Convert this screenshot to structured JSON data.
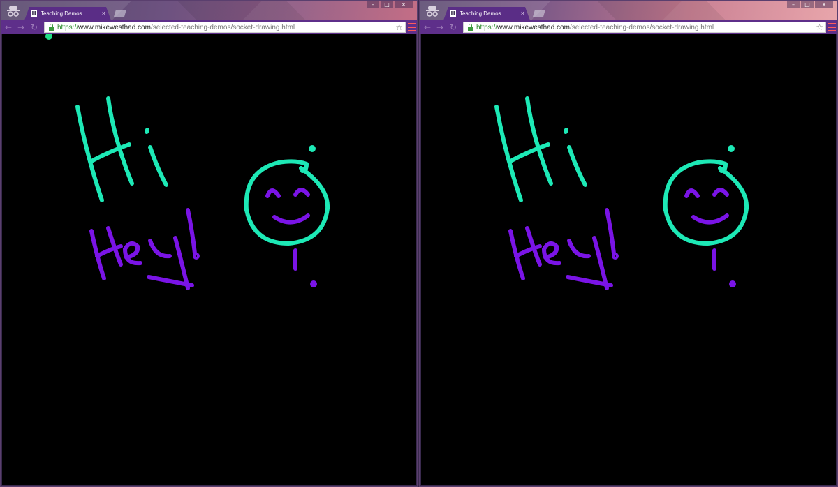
{
  "windows": [
    {
      "tab": {
        "title": "Teaching Demos",
        "favicon_letter": "H",
        "close_glyph": "×"
      },
      "address": {
        "scheme": "https://",
        "host": "www.mikewesthad.com",
        "path": "/selected-teaching-demos/socket-drawing.html"
      },
      "controls": {
        "minimize": "–",
        "maximize": "□",
        "close": "×"
      },
      "nav": {
        "back": "←",
        "forward": "→",
        "reload": "↻",
        "star": "☆"
      },
      "cursor_color": "#22dd88"
    },
    {
      "tab": {
        "title": "Teaching Demos",
        "favicon_letter": "H",
        "close_glyph": "×"
      },
      "address": {
        "scheme": "https://",
        "host": "www.mikewesthad.com",
        "path": "/selected-teaching-demos/socket-drawing.html"
      },
      "controls": {
        "minimize": "–",
        "maximize": "□",
        "close": "×"
      },
      "nav": {
        "back": "←",
        "forward": "→",
        "reload": "↻",
        "star": "☆"
      }
    }
  ],
  "drawing": {
    "canvas_background": "#000000",
    "colors": {
      "teal": "#1de9b6",
      "purple": "#7a14e6"
    },
    "handwritten_text": [
      "Hi",
      "Hey!"
    ],
    "icons": [
      "incognito-icon",
      "lock-icon",
      "star-icon",
      "menu-icon",
      "back-icon",
      "forward-icon",
      "reload-icon"
    ]
  }
}
